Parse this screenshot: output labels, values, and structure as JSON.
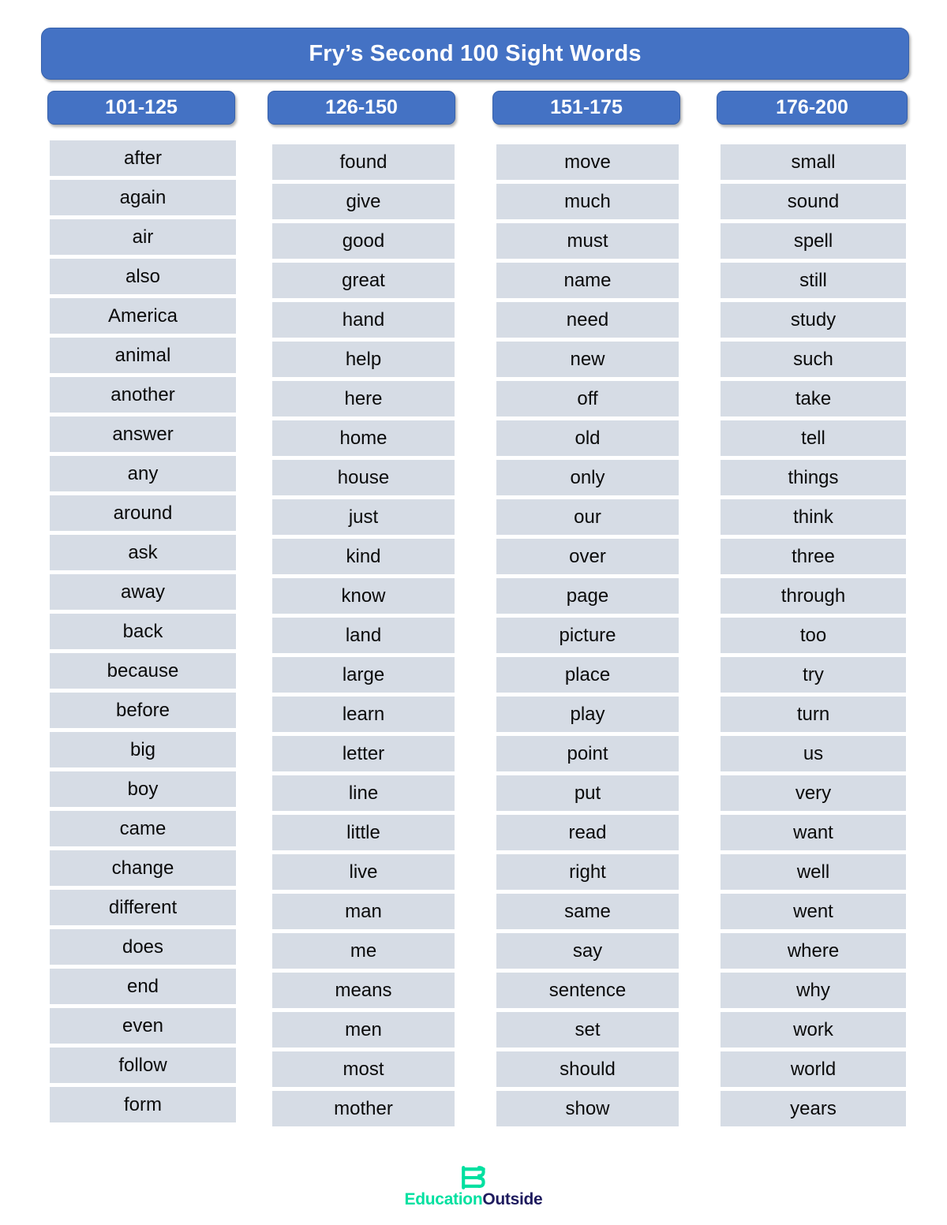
{
  "document": {
    "title": "Fry’s Second 100 Sight Words"
  },
  "theme": {
    "banner_blue": "#4472C4",
    "banner_border": "#3761AB",
    "cell_gray": "#D6DCE5",
    "word_text": "#0A0A0A",
    "banner_text": "#FFFFFF"
  },
  "columns": [
    {
      "header": "101-125",
      "words": [
        "after",
        "again",
        "air",
        "also",
        "America",
        "animal",
        "another",
        "answer",
        "any",
        "around",
        "ask",
        "away",
        "back",
        "because",
        "before",
        "big",
        "boy",
        "came",
        "change",
        "different",
        "does",
        "end",
        "even",
        "follow",
        "form"
      ]
    },
    {
      "header": "126-150",
      "words": [
        "found",
        "give",
        "good",
        "great",
        "hand",
        "help",
        "here",
        "home",
        "house",
        "just",
        "kind",
        "know",
        "land",
        "large",
        "learn",
        "letter",
        "line",
        "little",
        "live",
        "man",
        "me",
        "means",
        "men",
        "most",
        "mother"
      ]
    },
    {
      "header": "151-175",
      "words": [
        "move",
        "much",
        "must",
        "name",
        "need",
        "new",
        "off",
        "old",
        "only",
        "our",
        "over",
        "page",
        "picture",
        "place",
        "play",
        "point",
        "put",
        "read",
        "right",
        "same",
        "say",
        "sentence",
        "set",
        "should",
        "show"
      ]
    },
    {
      "header": "176-200",
      "words": [
        "small",
        "sound",
        "spell",
        "still",
        "study",
        "such",
        "take",
        "tell",
        "things",
        "think",
        "three",
        "through",
        "too",
        "try",
        "turn",
        "us",
        "very",
        "want",
        "well",
        "went",
        "where",
        "why",
        "work",
        "world",
        "years"
      ]
    }
  ],
  "footer": {
    "logo_icon": "stacked-book-e-icon",
    "logo_part_1": "Education",
    "logo_part_2": "Outside",
    "logo_color_1": "#00E0A0",
    "logo_color_2": "#1E1B5E"
  }
}
